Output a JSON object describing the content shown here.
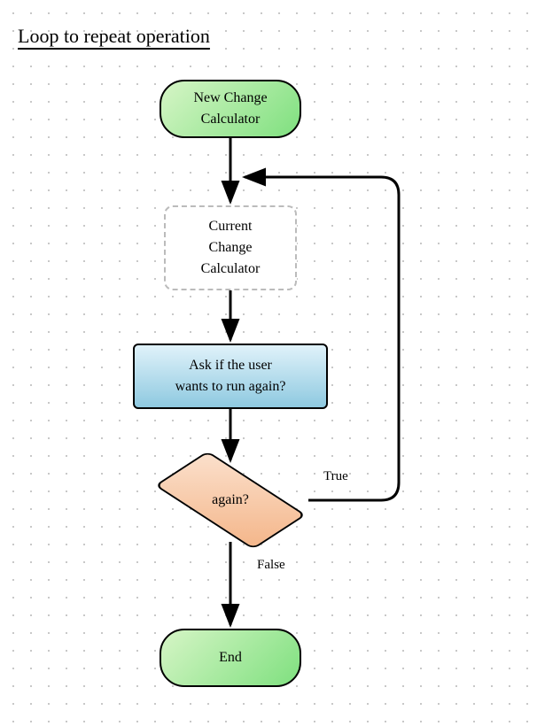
{
  "title": "Loop to repeat operation",
  "nodes": {
    "start": {
      "label": "New Change\nCalculator"
    },
    "subprocess": {
      "label": "Current\nChange\nCalculator"
    },
    "process": {
      "label": "Ask if the user\nwants to run again?"
    },
    "decision": {
      "label": "again?"
    },
    "end": {
      "label": "End"
    }
  },
  "edges": {
    "true": "True",
    "false": "False"
  }
}
